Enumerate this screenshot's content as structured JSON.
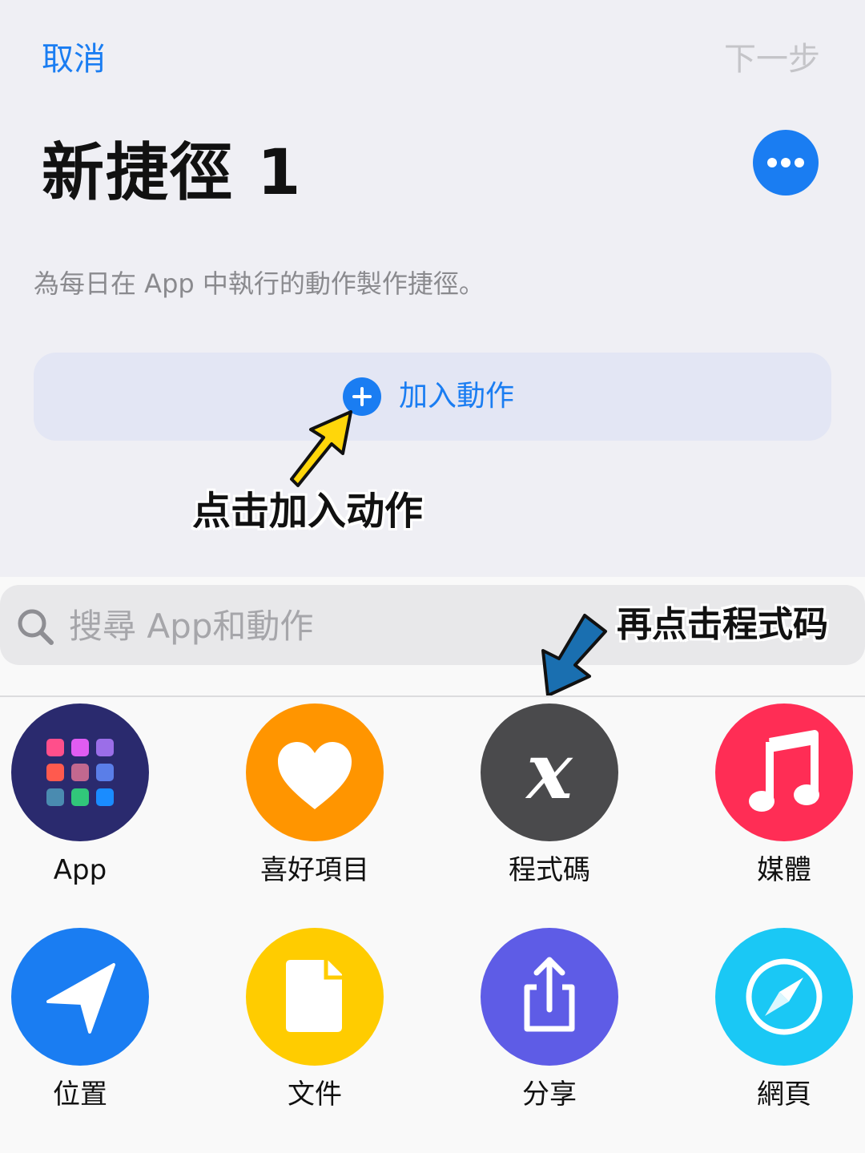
{
  "header": {
    "cancel_label": "取消",
    "next_label": "下一步"
  },
  "shortcut": {
    "title": "新捷徑 1",
    "description": "為每日在 App 中執行的動作製作捷徑。"
  },
  "add_action": {
    "label": "加入動作"
  },
  "annotations": {
    "tap_add_action": "点击加入动作",
    "tap_scripting": "再点击程式码"
  },
  "search": {
    "placeholder": "搜尋 App和動作"
  },
  "categories": [
    {
      "label": "App",
      "icon": "app-grid-icon",
      "color": "#2a2a6e"
    },
    {
      "label": "喜好項目",
      "icon": "heart-icon",
      "color": "#ff9500"
    },
    {
      "label": "程式碼",
      "icon": "scripting-x-icon",
      "color": "#4a4a4c"
    },
    {
      "label": "媒體",
      "icon": "music-note-icon",
      "color": "#ff2d55"
    },
    {
      "label": "位置",
      "icon": "location-arrow-icon",
      "color": "#1a7df2"
    },
    {
      "label": "文件",
      "icon": "document-icon",
      "color": "#ffcc00"
    },
    {
      "label": "分享",
      "icon": "share-icon",
      "color": "#5e5ce6"
    },
    {
      "label": "網頁",
      "icon": "safari-compass-icon",
      "color": "#1ac8f5"
    }
  ],
  "colors": {
    "accent": "#1a7df2",
    "annotation_arrow_yellow": "#ffd60a",
    "annotation_arrow_blue": "#1a6fb0"
  }
}
